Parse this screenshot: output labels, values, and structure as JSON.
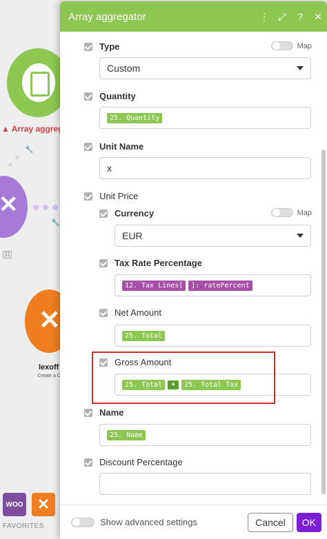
{
  "background": {
    "module_label": "Array aggrega",
    "lexoffice_label": "lexoff",
    "lexoffice_sub": "Create a C",
    "badge": "31",
    "favorites_label": "FAVORITES",
    "woo_label": "WOO"
  },
  "dialog": {
    "title": "Array aggregator",
    "header_icons": [
      "more-vertical-icon",
      "expand-icon",
      "help-icon",
      "close-icon"
    ],
    "accent_color": "#8cc751",
    "fields": {
      "type": {
        "label": "Type",
        "map_label": "Map",
        "value": "Custom"
      },
      "quantity": {
        "label": "Quantity",
        "tokens": [
          "25. Quantity"
        ]
      },
      "unit_name": {
        "label": "Unit Name",
        "value": "x"
      },
      "unit_price": {
        "label": "Unit Price"
      },
      "currency": {
        "label": "Currency",
        "map_label": "Map",
        "value": "EUR"
      },
      "tax_rate": {
        "label": "Tax Rate Percentage",
        "tokens": [
          "12. Tax Lines[",
          "]: ratePercent"
        ]
      },
      "net_amount": {
        "label": "Net Amount",
        "tokens": [
          "25. Total"
        ]
      },
      "gross_amount": {
        "label": "Gross Amount",
        "tokens": [
          "25. Total",
          "+",
          "25. Total Tax"
        ]
      },
      "name": {
        "label": "Name",
        "tokens": [
          "25. Name"
        ]
      },
      "discount": {
        "label": "Discount Percentage",
        "value": ""
      }
    },
    "footer": {
      "advanced_label": "Show advanced settings",
      "cancel_label": "Cancel",
      "ok_label": "OK",
      "ok_color": "#7b1fd6"
    }
  }
}
